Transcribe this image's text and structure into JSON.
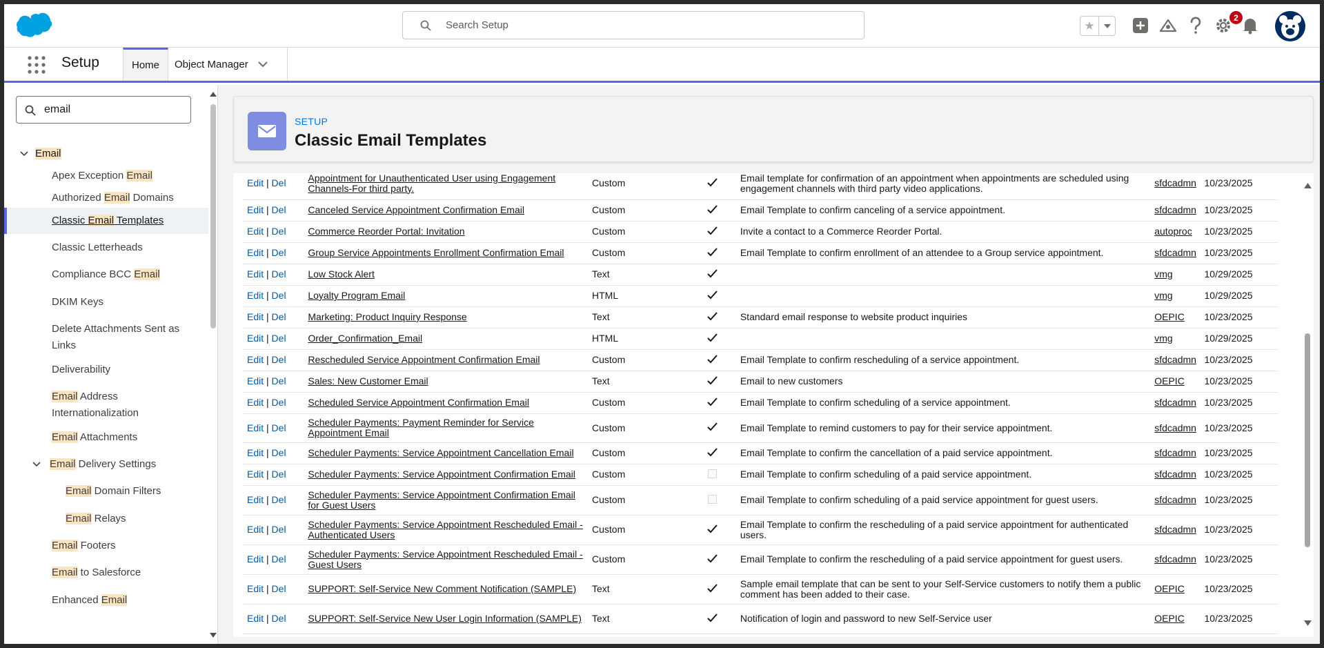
{
  "topbar": {
    "search_placeholder": "Search Setup",
    "notification_count": "2"
  },
  "nav": {
    "app_title": "Setup",
    "tabs": [
      {
        "label": "Home"
      },
      {
        "label": "Object Manager"
      }
    ]
  },
  "sidebar": {
    "quickfind_value": "email",
    "items": [
      {
        "pre": "",
        "hl": "Email",
        "post": ""
      },
      {
        "pre": "Apex Exception ",
        "hl": "Email",
        "post": ""
      },
      {
        "pre": "Authorized ",
        "hl": "Email",
        "post": " Domains"
      },
      {
        "pre": "Classic ",
        "hl": "Email",
        "post": " Templates"
      },
      {
        "pre": "Classic Letterheads",
        "hl": "",
        "post": ""
      },
      {
        "pre": "Compliance BCC ",
        "hl": "Email",
        "post": ""
      },
      {
        "pre": "DKIM Keys",
        "hl": "",
        "post": ""
      },
      {
        "pre": "Delete Attachments Sent as Links",
        "hl": "",
        "post": ""
      },
      {
        "pre": "Deliverability",
        "hl": "",
        "post": ""
      },
      {
        "pre": "",
        "hl": "Email",
        "post": " Address Internationalization"
      },
      {
        "pre": "",
        "hl": "Email",
        "post": " Attachments"
      },
      {
        "pre": "",
        "hl": "Email",
        "post": " Delivery Settings"
      },
      {
        "pre": "",
        "hl": "Email",
        "post": " Domain Filters"
      },
      {
        "pre": "",
        "hl": "Email",
        "post": " Relays"
      },
      {
        "pre": "",
        "hl": "Email",
        "post": " Footers"
      },
      {
        "pre": "",
        "hl": "Email",
        "post": " to Salesforce"
      },
      {
        "pre": "Enhanced ",
        "hl": "Email",
        "post": ""
      }
    ]
  },
  "page": {
    "supertitle": "SETUP",
    "title": "Classic Email Templates"
  },
  "table": {
    "edit_label": "Edit",
    "sep": "|",
    "del_label": "Del",
    "rows": [
      {
        "name": "Appointment for Unauthenticated User using Engagement Channels-For third party.",
        "type": "Custom",
        "active": true,
        "desc": "Email template for confirmation of an appointment when appointments are scheduled using engagement channels with third party video applications.",
        "owner": "sfdcadmn",
        "date": "10/23/2025"
      },
      {
        "name": "Canceled Service Appointment Confirmation Email",
        "type": "Custom",
        "active": true,
        "desc": "Email Template to confirm canceling of a service appointment.",
        "owner": "sfdcadmn",
        "date": "10/23/2025"
      },
      {
        "name": "Commerce Reorder Portal: Invitation",
        "type": "Custom",
        "active": true,
        "desc": "Invite a contact to a Commerce Reorder Portal.",
        "owner": "autoproc",
        "date": "10/23/2025"
      },
      {
        "name": "Group Service Appointments Enrollment Confirmation Email",
        "type": "Custom",
        "active": true,
        "desc": "Email Template to confirm enrollment of an attendee to a Group service appointment.",
        "owner": "sfdcadmn",
        "date": "10/23/2025"
      },
      {
        "name": "Low Stock Alert",
        "type": "Text",
        "active": true,
        "desc": "",
        "owner": "vmg",
        "date": "10/29/2025"
      },
      {
        "name": "Loyalty Program Email",
        "type": "HTML",
        "active": true,
        "desc": "",
        "owner": "vmg",
        "date": "10/29/2025"
      },
      {
        "name": "Marketing: Product Inquiry Response",
        "type": "Text",
        "active": true,
        "desc": "Standard email response to website product inquiries",
        "owner": "OEPIC",
        "date": "10/23/2025"
      },
      {
        "name": "Order_Confirmation_Email",
        "type": "HTML",
        "active": true,
        "desc": "",
        "owner": "vmg",
        "date": "10/29/2025"
      },
      {
        "name": "Rescheduled Service Appointment Confirmation Email",
        "type": "Custom",
        "active": true,
        "desc": "Email Template to confirm rescheduling of a service appointment.",
        "owner": "sfdcadmn",
        "date": "10/23/2025"
      },
      {
        "name": "Sales: New Customer Email",
        "type": "Text",
        "active": true,
        "desc": "Email to new customers",
        "owner": "OEPIC",
        "date": "10/23/2025"
      },
      {
        "name": "Scheduled Service Appointment Confirmation Email",
        "type": "Custom",
        "active": true,
        "desc": "Email Template to confirm scheduling of a service appointment.",
        "owner": "sfdcadmn",
        "date": "10/23/2025"
      },
      {
        "name": "Scheduler Payments: Payment Reminder for Service Appointment Email",
        "type": "Custom",
        "active": true,
        "desc": "Email Template to remind customers to pay for their service appointment.",
        "owner": "sfdcadmn",
        "date": "10/23/2025"
      },
      {
        "name": "Scheduler Payments: Service Appointment Cancellation Email",
        "type": "Custom",
        "active": true,
        "desc": "Email Template to confirm the cancellation of a paid service appointment.",
        "owner": "sfdcadmn",
        "date": "10/23/2025"
      },
      {
        "name": "Scheduler Payments: Service Appointment Confirmation Email",
        "type": "Custom",
        "active": false,
        "desc": "Email Template to confirm scheduling of a paid service appointment.",
        "owner": "sfdcadmn",
        "date": "10/23/2025"
      },
      {
        "name": "Scheduler Payments: Service Appointment Confirmation Email for Guest Users",
        "type": "Custom",
        "active": false,
        "desc": "Email Template to confirm scheduling of a paid service appointment for guest users.",
        "owner": "sfdcadmn",
        "date": "10/23/2025"
      },
      {
        "name": "Scheduler Payments: Service Appointment Rescheduled Email - Authenticated Users",
        "type": "Custom",
        "active": true,
        "desc": "Email Template to confirm the rescheduling of a paid service appointment for authenticated users.",
        "owner": "sfdcadmn",
        "date": "10/23/2025"
      },
      {
        "name": "Scheduler Payments: Service Appointment Rescheduled Email - Guest Users",
        "type": "Custom",
        "active": true,
        "desc": "Email Template to confirm the rescheduling of a paid service appointment for guest users.",
        "owner": "sfdcadmn",
        "date": "10/23/2025"
      },
      {
        "name": "SUPPORT: Self-Service New Comment Notification (SAMPLE)",
        "type": "Text",
        "active": true,
        "desc": "Sample email template that can be sent to your Self-Service customers to notify them a public comment has been added to their case.",
        "owner": "OEPIC",
        "date": "10/23/2025"
      },
      {
        "name": "SUPPORT: Self-Service New User Login Information (SAMPLE)",
        "type": "Text",
        "active": true,
        "desc": "Notification of login and password to new Self-Service user",
        "owner": "OEPIC",
        "date": "10/23/2025"
      }
    ]
  }
}
